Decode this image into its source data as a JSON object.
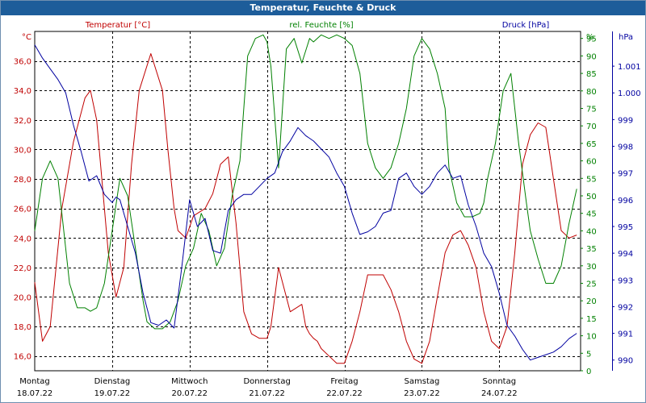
{
  "window": {
    "title": "Temperatur, Feuchte & Druck"
  },
  "chart_data": {
    "type": "line",
    "title": "Temperatur, Feuchte & Druck",
    "grid": true,
    "x_ticks": [
      {
        "day": "Montag",
        "date": "18.07.22"
      },
      {
        "day": "Dienstag",
        "date": "19.07.22"
      },
      {
        "day": "Mittwoch",
        "date": "20.07.22"
      },
      {
        "day": "Donnerstag",
        "date": "21.07.22"
      },
      {
        "day": "Freitag",
        "date": "22.07.22"
      },
      {
        "day": "Samstag",
        "date": "23.07.22"
      },
      {
        "day": "Sonntag",
        "date": "24.07.22"
      }
    ],
    "xlim": [
      0,
      7.05
    ],
    "axes": {
      "temperature": {
        "unit_label": "°C",
        "legend": "Temperatur [°C]",
        "color": "#c00000",
        "range": [
          15,
          38
        ],
        "ticks": [
          "16,0",
          "18,0",
          "20,0",
          "22,0",
          "24,0",
          "26,0",
          "28,0",
          "30,0",
          "32,0",
          "34,0",
          "36,0"
        ]
      },
      "humidity": {
        "unit_label": "%",
        "legend": "rel. Feuchte [%]",
        "color": "#008000",
        "range": [
          0,
          97
        ],
        "ticks": [
          "0",
          "5",
          "10",
          "15",
          "20",
          "25",
          "30",
          "35",
          "40",
          "45",
          "50",
          "55",
          "60",
          "65",
          "70",
          "75",
          "80",
          "85",
          "90",
          "95"
        ]
      },
      "pressure": {
        "unit_label": "hPa",
        "legend": "Druck [hPa]",
        "color": "#0000a0",
        "range": [
          989.6,
          1002.3
        ],
        "ticks": [
          "990",
          "991",
          "992",
          "993",
          "994",
          "995",
          "996",
          "997",
          "998",
          "999",
          "1.000",
          "1.001"
        ]
      }
    },
    "series": [
      {
        "name": "Temperatur [°C]",
        "axis": "temperature",
        "color": "#c00000",
        "x": [
          0,
          0.1,
          0.2,
          0.35,
          0.5,
          0.65,
          0.72,
          0.8,
          0.85,
          0.95,
          1.05,
          1.15,
          1.25,
          1.35,
          1.5,
          1.65,
          1.72,
          1.8,
          1.85,
          1.95,
          2.05,
          2.2,
          2.3,
          2.4,
          2.5,
          2.6,
          2.7,
          2.8,
          2.9,
          3.0,
          3.05,
          3.15,
          3.3,
          3.45,
          3.5,
          3.55,
          3.6,
          3.65,
          3.7,
          3.8,
          3.9,
          4.0,
          4.1,
          4.2,
          4.3,
          4.5,
          4.6,
          4.7,
          4.8,
          4.9,
          5.0,
          5.1,
          5.2,
          5.3,
          5.4,
          5.5,
          5.6,
          5.7,
          5.8,
          5.85,
          5.9,
          6.0,
          6.1,
          6.2,
          6.3,
          6.4,
          6.5,
          6.6,
          6.7,
          6.8,
          6.9,
          7.0
        ],
        "y": [
          21.0,
          17.0,
          18.0,
          26.0,
          30.5,
          33.5,
          34.0,
          32.0,
          29.0,
          23.0,
          20.0,
          22.0,
          29.0,
          34.0,
          36.5,
          34.0,
          30.0,
          26.0,
          24.5,
          24.0,
          25.5,
          26.0,
          27.0,
          29.0,
          29.5,
          25.0,
          19.0,
          17.5,
          17.2,
          17.2,
          18.0,
          22.0,
          19.0,
          19.5,
          18.0,
          17.5,
          17.2,
          17.0,
          16.5,
          16.0,
          15.5,
          15.5,
          17.0,
          19.0,
          21.5,
          21.5,
          20.5,
          19.0,
          17.0,
          15.8,
          15.5,
          17.0,
          20.0,
          23.0,
          24.2,
          24.5,
          23.5,
          22.0,
          19.0,
          18.0,
          17.0,
          16.5,
          18.0,
          23.0,
          29.0,
          31.0,
          31.8,
          31.5,
          28.0,
          24.5,
          24.0,
          24.2
        ]
      },
      {
        "name": "rel. Feuchte [%]",
        "axis": "humidity",
        "color": "#008000",
        "x": [
          0,
          0.1,
          0.2,
          0.3,
          0.35,
          0.45,
          0.55,
          0.65,
          0.72,
          0.8,
          0.9,
          1.0,
          1.1,
          1.2,
          1.3,
          1.4,
          1.45,
          1.55,
          1.65,
          1.75,
          1.85,
          1.95,
          2.05,
          2.15,
          2.25,
          2.35,
          2.45,
          2.55,
          2.65,
          2.75,
          2.85,
          2.95,
          3.0,
          3.05,
          3.15,
          3.25,
          3.35,
          3.45,
          3.55,
          3.6,
          3.7,
          3.8,
          3.9,
          4.0,
          4.1,
          4.2,
          4.3,
          4.4,
          4.5,
          4.6,
          4.7,
          4.8,
          4.9,
          5.0,
          5.1,
          5.2,
          5.3,
          5.35,
          5.45,
          5.55,
          5.65,
          5.75,
          5.8,
          5.85,
          5.95,
          6.05,
          6.15,
          6.25,
          6.35,
          6.4,
          6.5,
          6.6,
          6.7,
          6.8,
          6.9,
          7.0
        ],
        "y": [
          40,
          55,
          60,
          55,
          45,
          25,
          18,
          18,
          17,
          18,
          25,
          40,
          55,
          50,
          35,
          20,
          14,
          12,
          12,
          14,
          20,
          30,
          35,
          45,
          40,
          30,
          35,
          50,
          60,
          90,
          95,
          96,
          94,
          87,
          58,
          92,
          95,
          88,
          95,
          94,
          96,
          95,
          96,
          95,
          93,
          85,
          65,
          58,
          55,
          58,
          65,
          75,
          90,
          95,
          92,
          85,
          75,
          58,
          48,
          44,
          44,
          45,
          48,
          55,
          65,
          80,
          85,
          65,
          48,
          40,
          32,
          25,
          25,
          30,
          42,
          52
        ]
      },
      {
        "name": "Druck [hPa]",
        "axis": "pressure",
        "color": "#0000a0",
        "x": [
          0,
          0.1,
          0.2,
          0.3,
          0.4,
          0.5,
          0.6,
          0.7,
          0.8,
          0.9,
          1.0,
          1.05,
          1.1,
          1.2,
          1.3,
          1.4,
          1.5,
          1.6,
          1.7,
          1.8,
          1.9,
          2.0,
          2.1,
          2.2,
          2.3,
          2.4,
          2.5,
          2.6,
          2.7,
          2.8,
          2.9,
          3.0,
          3.1,
          3.2,
          3.3,
          3.4,
          3.5,
          3.6,
          3.7,
          3.8,
          3.9,
          4.0,
          4.1,
          4.2,
          4.3,
          4.4,
          4.5,
          4.6,
          4.7,
          4.8,
          4.9,
          5.0,
          5.1,
          5.2,
          5.3,
          5.4,
          5.5,
          5.6,
          5.7,
          5.8,
          5.9,
          6.0,
          6.1,
          6.2,
          6.3,
          6.4,
          6.5,
          6.6,
          6.7,
          6.8,
          6.9,
          7.0
        ],
        "y": [
          1001.8,
          1001.3,
          1000.9,
          1000.5,
          1000.0,
          998.8,
          997.8,
          996.7,
          996.9,
          996.2,
          995.9,
          996.1,
          996.0,
          995.0,
          994.0,
          992.5,
          991.4,
          991.3,
          991.5,
          991.2,
          993.5,
          996.0,
          995.0,
          995.3,
          994.1,
          994.0,
          995.6,
          996.0,
          996.2,
          996.2,
          996.5,
          996.8,
          997.0,
          997.8,
          998.2,
          998.7,
          998.4,
          998.2,
          997.9,
          997.6,
          997.0,
          996.5,
          995.5,
          994.7,
          994.8,
          995.0,
          995.5,
          995.6,
          996.8,
          997.0,
          996.5,
          996.2,
          996.5,
          997.0,
          997.3,
          996.8,
          996.9,
          995.8,
          995.0,
          994.0,
          993.5,
          992.5,
          991.3,
          990.9,
          990.4,
          990.0,
          990.1,
          990.2,
          990.3,
          990.5,
          990.8,
          991.0
        ]
      }
    ]
  }
}
